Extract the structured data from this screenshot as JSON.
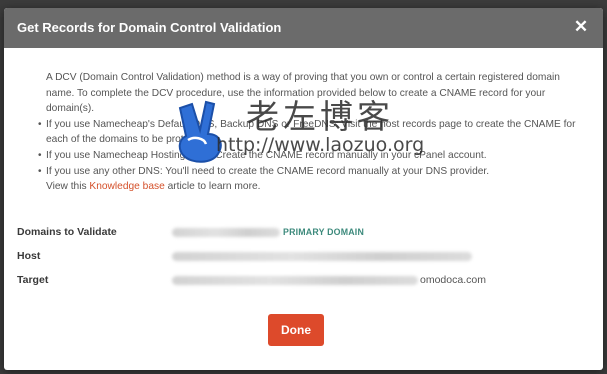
{
  "modal": {
    "title": "Get Records for Domain Control Validation",
    "close_icon": "close-icon"
  },
  "intro": {
    "paragraph": "A DCV (Domain Control Validation) method is a way of proving that you own or control a certain registered domain name. To complete the DCV procedure, use the information provided below to create a CNAME record for your domain(s).",
    "bullets": [
      "If you use Namecheap's Default DNS, Backup DNS or FreeDNS: Visit the host records page to create the CNAME for each of the domains to be protected.",
      "If you use Namecheap Hosting DNS: Create the CNAME record manually in your cPanel account.",
      "If you use any other DNS: You'll need to create the CNAME record manually at your DNS provider."
    ],
    "kb_prefix": "View this ",
    "kb_link": "Knowledge base",
    "kb_suffix": " article to learn more."
  },
  "watermark": {
    "cn": "老左博客",
    "url": "http://www.laozuo.org"
  },
  "fields": {
    "domains_label": "Domains to Validate",
    "primary_tag": "PRIMARY DOMAIN",
    "host_label": "Host",
    "target_label": "Target",
    "target_suffix": "omodoca.com"
  },
  "footer": {
    "done_label": "Done"
  },
  "colors": {
    "header_bg": "#6b6b6b",
    "accent_button": "#dd4a2b",
    "link": "#d4502a",
    "primary_tag": "#3d8a7c"
  }
}
